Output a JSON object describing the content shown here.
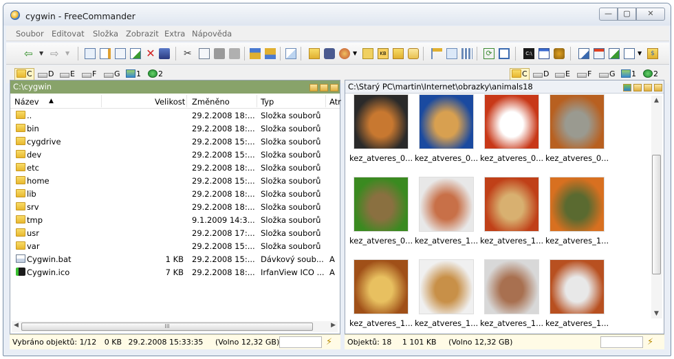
{
  "window": {
    "title": "cygwin - FreeCommander",
    "min": "—",
    "max": "▢",
    "close": "✕"
  },
  "menu": [
    "Soubor",
    "Editovat",
    "Složka",
    "Zobrazit",
    "Extra",
    "Nápověda"
  ],
  "drives_left": [
    "C",
    "D",
    "E",
    "F",
    "G",
    "1",
    "2"
  ],
  "drives_right": [
    "C",
    "D",
    "E",
    "F",
    "G",
    "1",
    "2"
  ],
  "left": {
    "path": "C:\\cygwin",
    "columns": {
      "name": "Název",
      "size": "Velikost",
      "modified": "Změněno",
      "type": "Typ",
      "attr": "Atr"
    },
    "rows": [
      {
        "name": "..",
        "size": "",
        "modified": "29.2.2008 18:...",
        "type": "Složka souborů",
        "attr": ""
      },
      {
        "name": "bin",
        "size": "",
        "modified": "29.2.2008 18:...",
        "type": "Složka souborů",
        "attr": ""
      },
      {
        "name": "cygdrive",
        "size": "",
        "modified": "29.2.2008 15:...",
        "type": "Složka souborů",
        "attr": ""
      },
      {
        "name": "dev",
        "size": "",
        "modified": "29.2.2008 15:...",
        "type": "Složka souborů",
        "attr": ""
      },
      {
        "name": "etc",
        "size": "",
        "modified": "29.2.2008 18:...",
        "type": "Složka souborů",
        "attr": ""
      },
      {
        "name": "home",
        "size": "",
        "modified": "29.2.2008 15:...",
        "type": "Složka souborů",
        "attr": ""
      },
      {
        "name": "lib",
        "size": "",
        "modified": "29.2.2008 18:...",
        "type": "Složka souborů",
        "attr": ""
      },
      {
        "name": "srv",
        "size": "",
        "modified": "29.2.2008 18:...",
        "type": "Složka souborů",
        "attr": ""
      },
      {
        "name": "tmp",
        "size": "",
        "modified": "9.1.2009 14:3...",
        "type": "Složka souborů",
        "attr": ""
      },
      {
        "name": "usr",
        "size": "",
        "modified": "29.2.2008 17:...",
        "type": "Složka souborů",
        "attr": ""
      },
      {
        "name": "var",
        "size": "",
        "modified": "29.2.2008 15:...",
        "type": "Složka souborů",
        "attr": ""
      },
      {
        "name": "Cygwin.bat",
        "size": "1 KB",
        "modified": "29.2.2008 15:...",
        "type": "Dávkový soub...",
        "attr": "A"
      },
      {
        "name": "Cygwin.ico",
        "size": "7 KB",
        "modified": "29.2.2008 18:...",
        "type": "IrfanView ICO ...",
        "attr": "A"
      }
    ],
    "hscroll_grip": "III",
    "status": {
      "selected": "Vybráno objektů: 1/12",
      "size": "0 KB",
      "date": "29.2.2008 15:33:35",
      "free": "(Volno 12,32 GB)"
    }
  },
  "right": {
    "path": "C:\\Starý PC\\martin\\Internet\\obrazky\\animals18",
    "thumbs": [
      {
        "cap": "kez_atveres_0...",
        "c1": "#2a2a2a",
        "c2": "#c87830"
      },
      {
        "cap": "kez_atveres_0...",
        "c1": "#1a4aa0",
        "c2": "#d8a050"
      },
      {
        "cap": "kez_atveres_0...",
        "c1": "#c83818",
        "c2": "#ffffff"
      },
      {
        "cap": "kez_atveres_0...",
        "c1": "#b86020",
        "c2": "#9a9a90"
      },
      {
        "cap": "kez_atveres_0...",
        "c1": "#3a8a20",
        "c2": "#8a7040"
      },
      {
        "cap": "kez_atveres_1...",
        "c1": "#e8e8e8",
        "c2": "#c87048"
      },
      {
        "cap": "kez_atveres_1...",
        "c1": "#c04018",
        "c2": "#d8b070"
      },
      {
        "cap": "kez_atveres_1...",
        "c1": "#d87020",
        "c2": "#5a6a30"
      },
      {
        "cap": "kez_atveres_1...",
        "c1": "#a05018",
        "c2": "#e8c060"
      },
      {
        "cap": "kez_atveres_1...",
        "c1": "#f0f0f0",
        "c2": "#c89048"
      },
      {
        "cap": "kez_atveres_1...",
        "c1": "#d8d8d8",
        "c2": "#a87050"
      },
      {
        "cap": "kez_atveres_1...",
        "c1": "#b85020",
        "c2": "#e8e8e8"
      }
    ],
    "status": {
      "objects": "Objektů: 18",
      "size": "1 101 KB",
      "free": "(Volno 12,32 GB)"
    }
  },
  "colors": {
    "left_path_bg": "#88a36a",
    "status_bg": "#fffbe6"
  }
}
